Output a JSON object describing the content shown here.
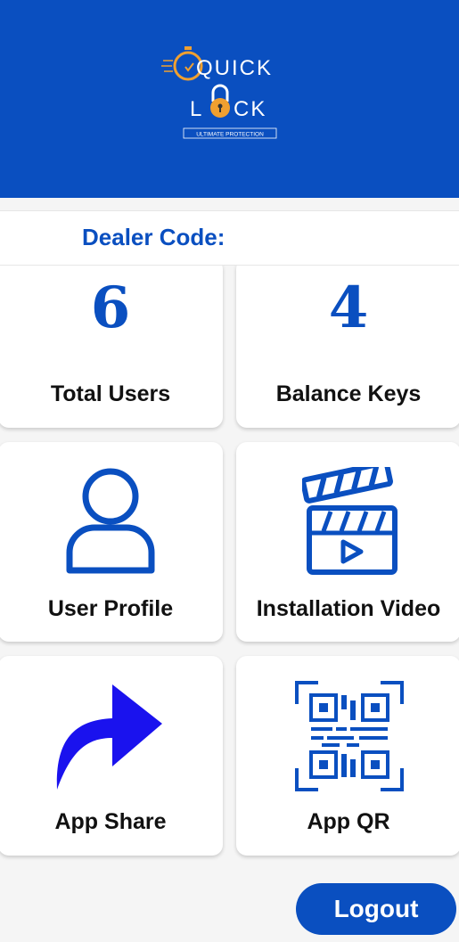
{
  "header": {
    "logo_line1": "QUICK",
    "logo_line2_left": "L",
    "logo_line2_right": "CK",
    "logo_tagline": "ULTIMATE PROTECTION",
    "bg_color": "#0a4fc0"
  },
  "dealer": {
    "label": "Dealer Code:"
  },
  "stats": {
    "total_users": {
      "value": "6",
      "label": "Total Users"
    },
    "balance_keys": {
      "value": "4",
      "label": "Balance Keys"
    }
  },
  "menu": {
    "user_profile": {
      "label": "User Profile",
      "icon": "user-icon"
    },
    "installation_video": {
      "label": "Installation Video",
      "icon": "clapperboard-play-icon"
    },
    "app_share": {
      "label": "App Share",
      "icon": "share-arrow-icon"
    },
    "app_qr": {
      "label": "App QR",
      "icon": "qr-code-icon"
    }
  },
  "logout_label": "Logout",
  "colors": {
    "accent": "#0a4fc0",
    "share_arrow": "#1a12ee",
    "lock_orange": "#f0a030"
  }
}
